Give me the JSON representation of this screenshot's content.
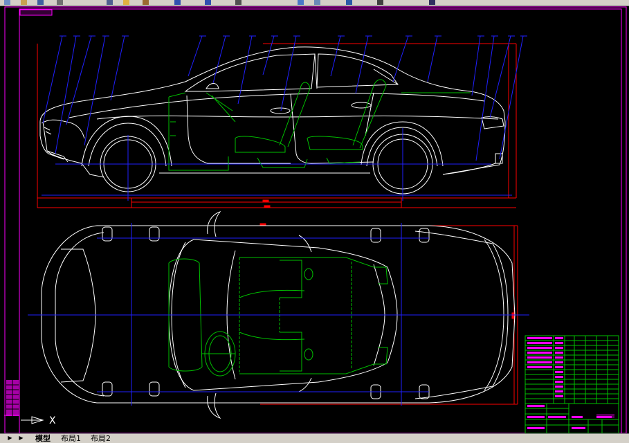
{
  "tabs": [
    {
      "label": "模型",
      "active": true
    },
    {
      "label": "布局1",
      "active": false
    },
    {
      "label": "布局2",
      "active": false
    }
  ],
  "ucs": {
    "x_label": "X"
  },
  "colors": {
    "background": "#000000",
    "outline": "#ffffff",
    "interior": "#00c000",
    "leader": "#2020ff",
    "dimension": "#ff0000",
    "frame": "#ff00ff",
    "centerline": "#2020ff"
  },
  "icons": [
    "new-icon",
    "open-icon",
    "save-icon",
    "print-icon",
    "cut-icon",
    "copy-icon",
    "paste-icon",
    "undo-icon",
    "redo-icon",
    "pan-icon",
    "zoom-icon",
    "properties-icon",
    "layer-icon"
  ]
}
